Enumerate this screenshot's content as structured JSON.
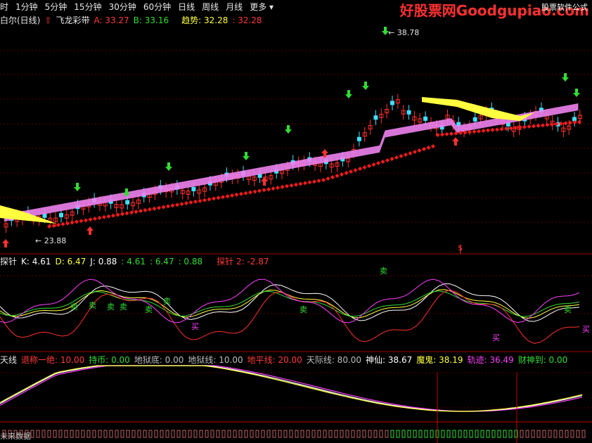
{
  "menu": [
    "时",
    "1分钟",
    "5分钟",
    "15分钟",
    "30分钟",
    "60分钟",
    "日线",
    "周线",
    "月线",
    "更多"
  ],
  "watermark": {
    "main": "好股票网Goodgupiao.com",
    "sub": "股票软件公式"
  },
  "panel1": {
    "name": "白尔(日线)",
    "indicator": "飞龙彩带",
    "a_label": "A: 33.27",
    "b_label": "B: 33.16",
    "trend_label": "趋势: 32.28",
    "trend_value": ": 32.28",
    "high_label": "38.78",
    "low_label": "23.88",
    "marker": "$"
  },
  "panel2": {
    "name": "探针",
    "k": "K: 4.61",
    "d": "D: 6.47",
    "j": "J: 0.88",
    "v1": ": 4.61",
    "v2": ": 6.47",
    "v3": ": 0.88",
    "probe2": "探针 2: -2.87",
    "sell_label": "卖",
    "buy_label": "买"
  },
  "panel3": {
    "name": "天线",
    "items": [
      {
        "text": "退称一绝: 10.00",
        "color": "#ff3a3a"
      },
      {
        "text": "持币: 0.00",
        "color": "#33dd33"
      },
      {
        "text": "地狱底: 0.00",
        "color": "#bdbdbd"
      },
      {
        "text": "地狱线: 10.00",
        "color": "#bdbdbd"
      },
      {
        "text": "地平线: 20.00",
        "color": "#ff3a3a"
      },
      {
        "text": "天际线: 80.00",
        "color": "#bdbdbd"
      },
      {
        "text": "神仙: 38.67",
        "color": "#ffffff"
      },
      {
        "text": "魔鬼: 38.19",
        "color": "#ffff40"
      },
      {
        "text": "轨迹: 36.49",
        "color": "#ff40ff"
      },
      {
        "text": "财神到: 0.00",
        "color": "#33dd33"
      }
    ]
  },
  "bottom_label": "未来数据",
  "colors": {
    "up": "#ff3030",
    "down": "#40e0ff",
    "ribbon_pink": "#ee82ee",
    "ribbon_yellow": "#ffff40",
    "dots": "#ff1a1a"
  }
}
